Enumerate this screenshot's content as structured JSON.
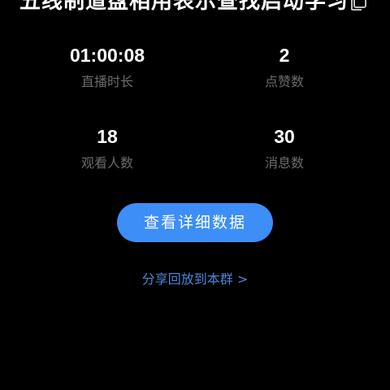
{
  "header": {
    "title": "五线制道盘相用表示查找启动学习",
    "copy_icon": "copy-icon"
  },
  "stats": [
    {
      "value": "01:00:08",
      "label": "直播时长"
    },
    {
      "value": "2",
      "label": "点赞数"
    },
    {
      "value": "18",
      "label": "观看人数"
    },
    {
      "value": "30",
      "label": "消息数"
    }
  ],
  "actions": {
    "details_button": "查看详细数据",
    "share_link": "分享回放到本群 >"
  },
  "colors": {
    "background": "#000000",
    "button": "#3d8ef6",
    "link": "#4a86d6",
    "label": "#6b6b6b"
  }
}
